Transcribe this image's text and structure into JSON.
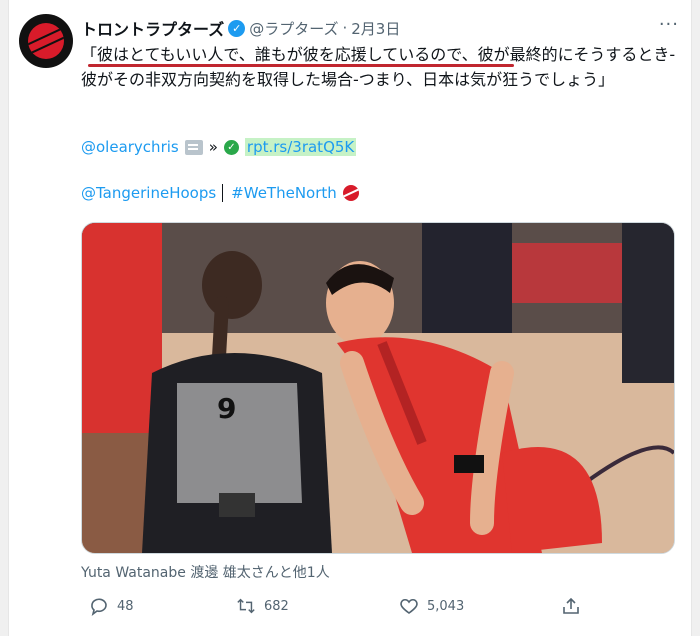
{
  "tweet": {
    "account_name": "トロントラプターズ",
    "handle": "@ラプターズ",
    "separator": "·",
    "date": "2月3日",
    "text": "「彼はとてもいい人で、誰もが彼を応援しているので、彼が最終的にそうするとき-彼がその非双方向契約を取得した場合-つまり、日本は気が狂うでしょう」",
    "mention_link": "@olearychris",
    "arrow": "»",
    "short_link": "rpt.rs/3ratQ5K",
    "tag_mention": "@TangerineHoops",
    "hashtag": "#WeTheNorth",
    "photo_caption": "Yuta Watanabe 渡邊 雄太さんと他1人",
    "jersey_number": "9",
    "more_menu": "···"
  },
  "actions": {
    "reply_count": "48",
    "retweet_count": "682",
    "like_count": "5,043"
  },
  "icons": {
    "avatar": "raptors-logo-icon",
    "verified": "verified-badge-icon",
    "reply": "reply-icon",
    "retweet": "retweet-icon",
    "like": "heart-icon",
    "share": "share-icon"
  },
  "colors": {
    "link": "#1d9bf0",
    "brand_red": "#d81b2a",
    "highlight": "#c6f2c6"
  }
}
